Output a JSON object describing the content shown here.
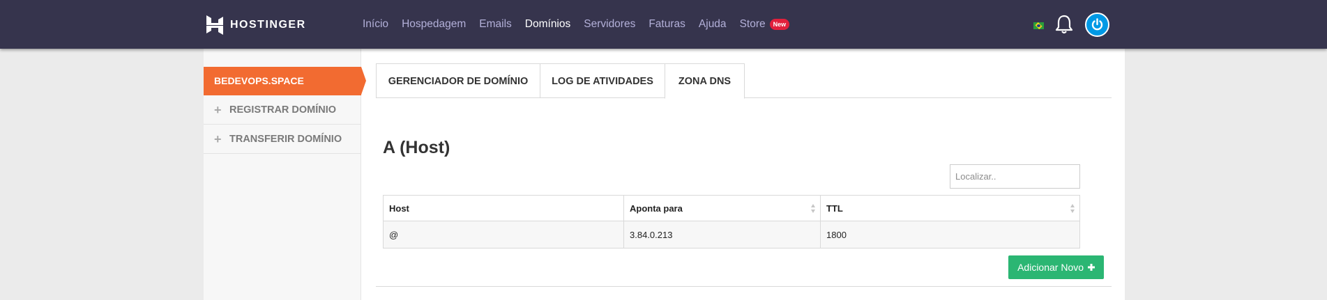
{
  "brand": {
    "name": "HOSTINGER"
  },
  "nav": {
    "items": [
      {
        "label": "Início",
        "active": false
      },
      {
        "label": "Hospedagem",
        "active": false
      },
      {
        "label": "Emails",
        "active": false
      },
      {
        "label": "Domínios",
        "active": true
      },
      {
        "label": "Servidores",
        "active": false
      },
      {
        "label": "Faturas",
        "active": false
      },
      {
        "label": "Ajuda",
        "active": false
      }
    ],
    "store": {
      "label": "Store",
      "badge": "New"
    },
    "icons": [
      "brazil-flag-icon",
      "bell-icon",
      "power-icon"
    ]
  },
  "sidebar": {
    "active": "BEDEVOPS.SPACE",
    "items": [
      {
        "label": "REGISTRAR DOMÍNIO",
        "icon": "plus-icon"
      },
      {
        "label": "TRANSFERIR DOMÍNIO",
        "icon": "plus-icon"
      }
    ]
  },
  "tabs": [
    {
      "label": "GERENCIADOR DE DOMÍNIO",
      "active": false
    },
    {
      "label": "LOG DE ATIVIDADES",
      "active": false
    },
    {
      "label": "ZONA DNS",
      "active": true
    }
  ],
  "section": {
    "title": "A (Host)",
    "search_placeholder": "Localizar..",
    "table": {
      "headers": [
        "Host",
        "Aponta para",
        "TTL"
      ],
      "rows": [
        [
          "@",
          "3.84.0.213",
          "1800"
        ]
      ]
    },
    "add_button": "Adicionar Novo"
  },
  "colors": {
    "topbar": "#36344d",
    "accent_orange": "#f26b31",
    "button_green": "#2bb673",
    "badge_red": "#e1203c",
    "power_blue": "#0099e5"
  }
}
